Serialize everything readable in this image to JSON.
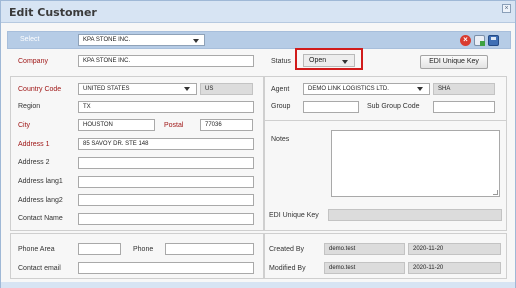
{
  "dialog": {
    "title": "Edit Customer"
  },
  "header": {
    "select_label": "Select",
    "select_value": "KPA STONE INC."
  },
  "company": {
    "label": "Company",
    "value": "KPA STONE INC."
  },
  "status": {
    "label": "Status",
    "value": "Open"
  },
  "edi_unique_key_button": "EDI Unique Key",
  "country_code": {
    "label": "Country Code",
    "value": "UNITED STATES",
    "code": "US"
  },
  "region": {
    "label": "Region",
    "value": "TX"
  },
  "city": {
    "label": "City",
    "value": "HOUSTON"
  },
  "postal": {
    "label": "Postal",
    "value": "77036"
  },
  "address1": {
    "label": "Address 1",
    "value": "85 SAVOY DR. STE 148"
  },
  "address2": {
    "label": "Address 2",
    "value": ""
  },
  "address_lang1": {
    "label": "Address lang1",
    "value": ""
  },
  "address_lang2": {
    "label": "Address lang2",
    "value": ""
  },
  "contact_name": {
    "label": "Contact Name",
    "value": ""
  },
  "agent": {
    "label": "Agent",
    "value": "DEMO LINK LOGISTICS LTD.",
    "code": "SHA"
  },
  "group": {
    "label": "Group",
    "value": ""
  },
  "sub_group_code": {
    "label": "Sub Group Code",
    "value": ""
  },
  "notes": {
    "label": "Notes",
    "value": ""
  },
  "edi_unique_key": {
    "label": "EDI Unique Key",
    "value": ""
  },
  "phone_area": {
    "label": "Phone Area",
    "value": ""
  },
  "phone": {
    "label": "Phone",
    "value": ""
  },
  "contact_email": {
    "label": "Contact email",
    "value": ""
  },
  "created_by": {
    "label": "Created By",
    "user": "demo.test",
    "date": "2020-11-20"
  },
  "modified_by": {
    "label": "Modified By",
    "user": "demo.test",
    "date": "2020-11-20"
  },
  "icons": [
    "close-icon",
    "delete-icon",
    "copy-icon",
    "save-icon",
    "chevron-down-icon"
  ],
  "colors": {
    "required_label": "#a01818",
    "header_bar": "#b6cce6",
    "highlight": "#d11c1c"
  }
}
